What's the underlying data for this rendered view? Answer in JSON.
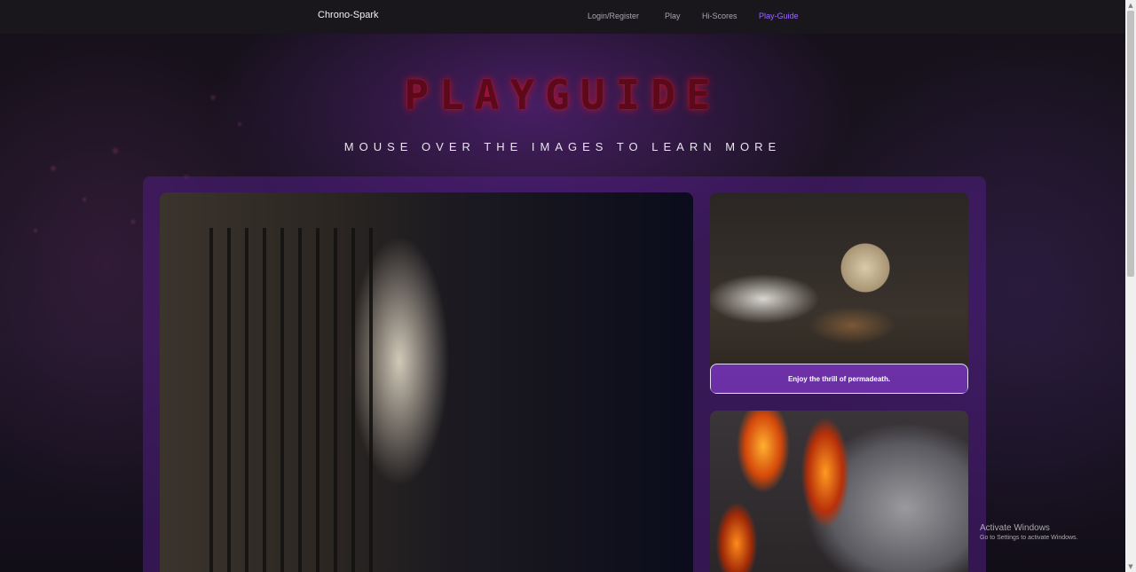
{
  "navbar": {
    "brand": "Chrono-Spark",
    "links": [
      {
        "label": "Login/Register"
      },
      {
        "label": "Play"
      },
      {
        "label": "Hi-Scores"
      },
      {
        "label": "Play-Guide",
        "active": true
      }
    ]
  },
  "header": {
    "title": "PLAYGUIDE",
    "subtitle": "MOUSE OVER THE IMAGES TO LEARN MORE"
  },
  "gallery": {
    "images": [
      {
        "name": "prison-cell-image"
      },
      {
        "name": "skull-image",
        "caption": "Enjoy the thrill of permadeath."
      },
      {
        "name": "fire-knight-image"
      }
    ]
  },
  "watermark": {
    "title": "Activate Windows",
    "subtitle": "Go to Settings to activate Windows."
  },
  "colors": {
    "accent": "#9a6cff",
    "title_glow": "#c0122c",
    "panel": "#50208a"
  }
}
